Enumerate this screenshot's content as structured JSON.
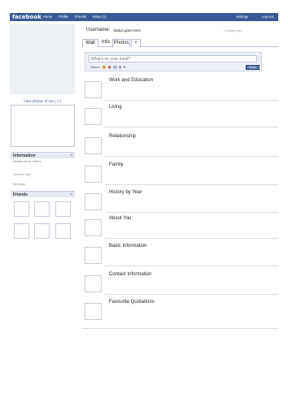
{
  "topbar": {
    "logo": "facebook",
    "nav": [
      "Home",
      "Profile",
      "Friends",
      "Inbox (1)"
    ],
    "settings": "Settings",
    "logout": "Log out"
  },
  "sidebar": {
    "view_photos": "View photos of me ( 1 )",
    "information": {
      "heading": "Information",
      "fields": [
        "Relationship Status:",
        "Current City:",
        "Birthday:"
      ]
    },
    "friends": {
      "heading": "Friends"
    }
  },
  "profile": {
    "username_label": "Username:",
    "status": "Status goes here",
    "timestamp": "2 minutes ago"
  },
  "tabs": [
    "Wall",
    "Info",
    "Photos",
    "+"
  ],
  "composer": {
    "placeholder": "What's on your mind?",
    "attach_label": "Attach:",
    "share_label": "Share"
  },
  "sections": [
    "Work and Education",
    "Living",
    "Relationship",
    "Family",
    "History by Year",
    "About You",
    "Basic Information",
    "Contact Information",
    "Favourite Quotations"
  ],
  "colors": {
    "brand": "#3b5998",
    "button": "#5b74a8"
  }
}
